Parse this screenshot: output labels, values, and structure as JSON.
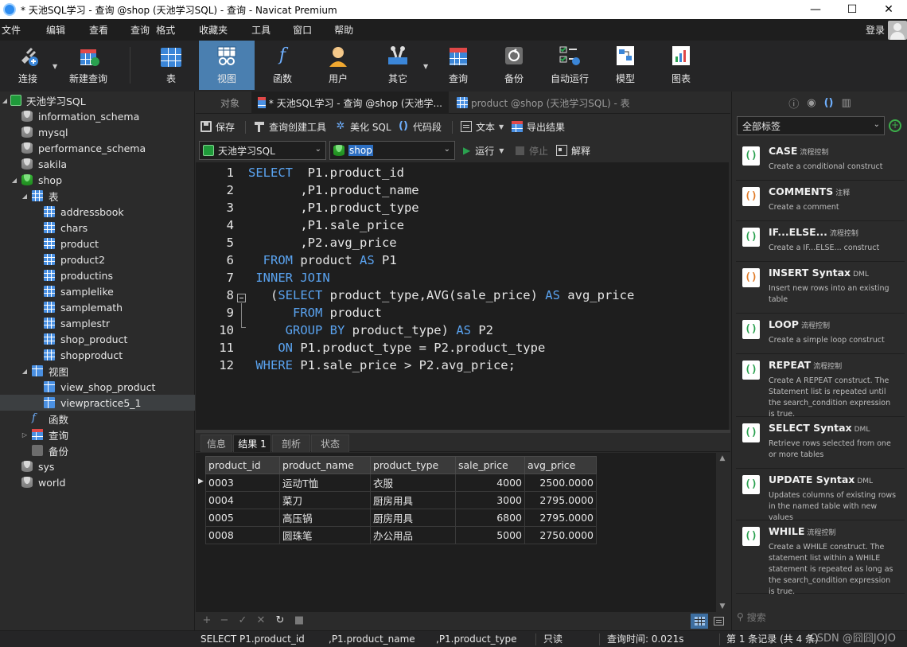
{
  "window": {
    "title": "* 天池SQL学习 - 查询 @shop (天池学习SQL) - 查询 - Navicat Premium",
    "minimize_label": "—",
    "maximize_label": "☐",
    "close_label": "✕"
  },
  "menu": {
    "items": [
      "文件",
      "编辑",
      "查看",
      "查询",
      "格式",
      "收藏夹",
      "工具",
      "窗口",
      "帮助"
    ],
    "login_label": "登录"
  },
  "toolbar": {
    "buttons": [
      "连接",
      "新建查询",
      "表",
      "视图",
      "函数",
      "用户",
      "其它",
      "查询",
      "备份",
      "自动运行",
      "模型",
      "图表"
    ],
    "active": "视图"
  },
  "tree": {
    "items": [
      {
        "label": "天池学习SQL",
        "icon": "connection-icon"
      },
      {
        "label": "information_schema",
        "icon": "database-icon"
      },
      {
        "label": "mysql",
        "icon": "database-icon"
      },
      {
        "label": "performance_schema",
        "icon": "database-icon"
      },
      {
        "label": "sakila",
        "icon": "database-icon"
      },
      {
        "label": "shop",
        "icon": "database-icon"
      },
      {
        "label": "表",
        "icon": "tables-folder-icon"
      },
      {
        "label": "addressbook",
        "icon": "table-icon"
      },
      {
        "label": "chars",
        "icon": "table-icon"
      },
      {
        "label": "product",
        "icon": "table-icon"
      },
      {
        "label": "product2",
        "icon": "table-icon"
      },
      {
        "label": "productins",
        "icon": "table-icon"
      },
      {
        "label": "samplelike",
        "icon": "table-icon"
      },
      {
        "label": "samplemath",
        "icon": "table-icon"
      },
      {
        "label": "samplestr",
        "icon": "table-icon"
      },
      {
        "label": "shop_product",
        "icon": "table-icon"
      },
      {
        "label": "shopproduct",
        "icon": "table-icon"
      },
      {
        "label": "视图",
        "icon": "views-folder-icon"
      },
      {
        "label": "view_shop_product",
        "icon": "view-icon"
      },
      {
        "label": "viewpractice5_1",
        "icon": "view-icon"
      },
      {
        "label": "函数",
        "icon": "function-icon"
      },
      {
        "label": "查询",
        "icon": "query-icon"
      },
      {
        "label": "备份",
        "icon": "backup-icon"
      },
      {
        "label": "sys",
        "icon": "database-icon"
      },
      {
        "label": "world",
        "icon": "database-icon"
      }
    ]
  },
  "tabs": {
    "objects": "对象",
    "query": "* 天池SQL学习 - 查询 @shop (天池学...",
    "product": "product @shop (天池学习SQL) - 表"
  },
  "editor_toolbar": {
    "save": "保存",
    "query_builder": "查询创建工具",
    "beautify": "美化 SQL",
    "snippet": "代码段",
    "text": "文本",
    "export": "导出结果",
    "connection": "天池学习SQL",
    "database": "shop",
    "run": "运行",
    "stop": "停止",
    "explain": "解释"
  },
  "code": {
    "lines": [
      {
        "n": "1",
        "parts": [
          {
            "t": "SELECT",
            "k": true
          },
          {
            "t": "  P1.product_id"
          }
        ]
      },
      {
        "n": "2",
        "parts": [
          {
            "t": "       ,P1.product_name"
          }
        ]
      },
      {
        "n": "3",
        "parts": [
          {
            "t": "       ,P1.product_type"
          }
        ]
      },
      {
        "n": "4",
        "parts": [
          {
            "t": "       ,P1.sale_price"
          }
        ]
      },
      {
        "n": "5",
        "parts": [
          {
            "t": "       ,P2.avg_price"
          }
        ]
      },
      {
        "n": "6",
        "parts": [
          {
            "t": "  "
          },
          {
            "t": "FROM",
            "k": true
          },
          {
            "t": " product "
          },
          {
            "t": "AS",
            "k": true
          },
          {
            "t": " P1"
          }
        ]
      },
      {
        "n": "7",
        "parts": [
          {
            "t": " "
          },
          {
            "t": "INNER JOIN",
            "k": true
          }
        ]
      },
      {
        "n": "8",
        "parts": [
          {
            "t": "   ("
          },
          {
            "t": "SELECT",
            "k": true
          },
          {
            "t": " product_type,AVG(sale_price) "
          },
          {
            "t": "AS",
            "k": true
          },
          {
            "t": " avg_price"
          }
        ]
      },
      {
        "n": "9",
        "parts": [
          {
            "t": "      "
          },
          {
            "t": "FROM",
            "k": true
          },
          {
            "t": " product"
          }
        ]
      },
      {
        "n": "10",
        "parts": [
          {
            "t": "     "
          },
          {
            "t": "GROUP BY",
            "k": true
          },
          {
            "t": " product_type) "
          },
          {
            "t": "AS",
            "k": true
          },
          {
            "t": " P2"
          }
        ]
      },
      {
        "n": "11",
        "parts": [
          {
            "t": "    "
          },
          {
            "t": "ON",
            "k": true
          },
          {
            "t": " P1.product_type = P2.product_type"
          }
        ]
      },
      {
        "n": "12",
        "parts": [
          {
            "t": " "
          },
          {
            "t": "WHERE",
            "k": true
          },
          {
            "t": " P1.sale_price > P2.avg_price;"
          }
        ]
      }
    ]
  },
  "result_tabs": [
    "信息",
    "结果 1",
    "剖析",
    "状态"
  ],
  "results": {
    "columns": [
      "product_id",
      "product_name",
      "product_type",
      "sale_price",
      "avg_price"
    ],
    "rows": [
      [
        "0003",
        "运动T恤",
        "衣服",
        "4000",
        "2500.0000"
      ],
      [
        "0004",
        "菜刀",
        "厨房用具",
        "3000",
        "2795.0000"
      ],
      [
        "0005",
        "高压锅",
        "厨房用具",
        "6800",
        "2795.0000"
      ],
      [
        "0008",
        "圆珠笔",
        "办公用品",
        "5000",
        "2750.0000"
      ]
    ]
  },
  "snippets": {
    "filter": "全部标签",
    "items": [
      {
        "name": "CASE",
        "tag": "流程控制",
        "desc": "Create a conditional construct"
      },
      {
        "name": "COMMENTS",
        "tag": "注释",
        "desc": "Create a comment"
      },
      {
        "name": "IF...ELSE...",
        "tag": "流程控制",
        "desc": "Create a IF...ELSE... construct"
      },
      {
        "name": "INSERT Syntax",
        "tag": "DML",
        "desc": "Insert new rows into an existing table"
      },
      {
        "name": "LOOP",
        "tag": "流程控制",
        "desc": "Create a simple loop construct"
      },
      {
        "name": "REPEAT",
        "tag": "流程控制",
        "desc": "Create A REPEAT construct. The Statement list is repeated until the search_condition expression is true."
      },
      {
        "name": "SELECT Syntax",
        "tag": "DML",
        "desc": "Retrieve rows selected from one or more tables"
      },
      {
        "name": "UPDATE Syntax",
        "tag": "DML",
        "desc": "Updates columns of existing rows in the named table with new values"
      },
      {
        "name": "WHILE",
        "tag": "流程控制",
        "desc": "Create a WHILE construct. The statement list within a WHILE statement is repeated as long as the search_condition expression is true."
      }
    ],
    "search_placeholder": "搜索"
  },
  "status": {
    "sql1": "SELECT  P1.product_id",
    "sql2": ",P1.product_name",
    "sql3": ",P1.product_type",
    "readonly": "只读",
    "query_time": "查询时间: 0.021s",
    "record": "第 1 条记录 (共 4 条)",
    "watermark": "CSDN @囧囧JOJO"
  },
  "colors": {
    "accent": "#4a7fb0",
    "keyword": "#5aa3f0",
    "background": "#2b2b2b"
  }
}
